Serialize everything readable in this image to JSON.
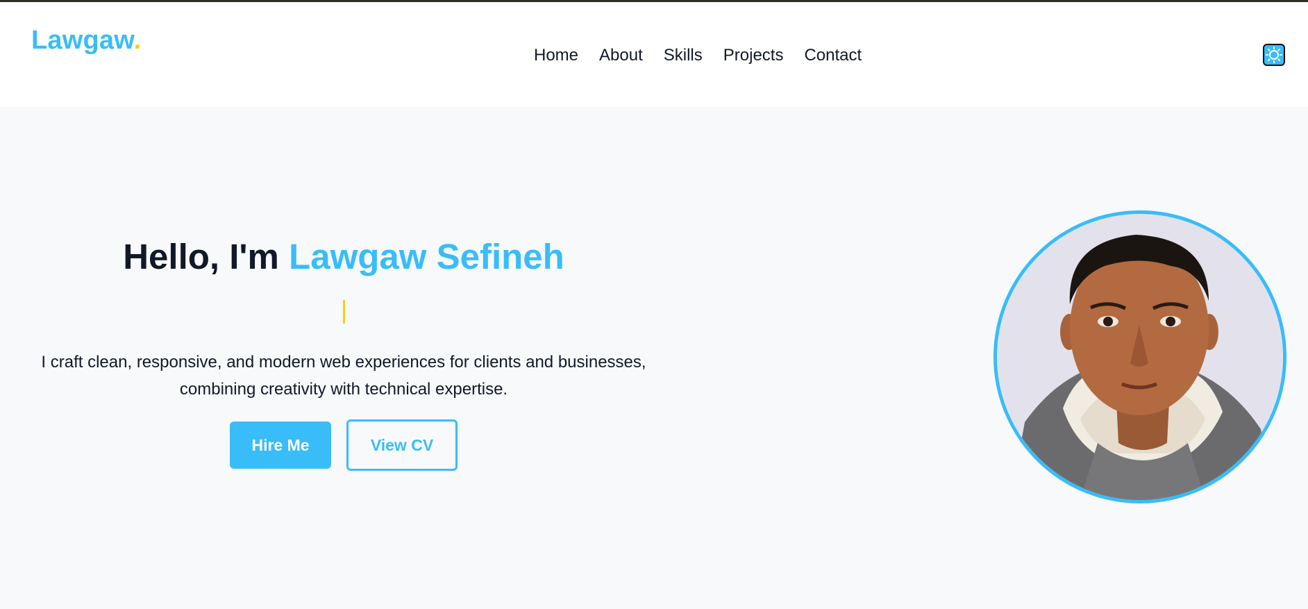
{
  "header": {
    "logo_text": "Lawgaw",
    "logo_dot": ".",
    "nav": [
      {
        "label": "Home"
      },
      {
        "label": "About"
      },
      {
        "label": "Skills"
      },
      {
        "label": "Projects"
      },
      {
        "label": "Contact"
      }
    ],
    "theme_toggle_icon": "sun-icon"
  },
  "hero": {
    "greeting": "Hello, I'm",
    "name": "Lawgaw Sefineh",
    "description_line1": "I craft clean, responsive, and modern web experiences for clients and businesses,",
    "description_line2": "combining creativity with technical expertise.",
    "hire_label": "Hire Me",
    "cv_label": "View CV"
  },
  "colors": {
    "accent": "#38bdf8",
    "highlight": "#facc15",
    "text": "#111827",
    "background": "#f8f9fb"
  }
}
